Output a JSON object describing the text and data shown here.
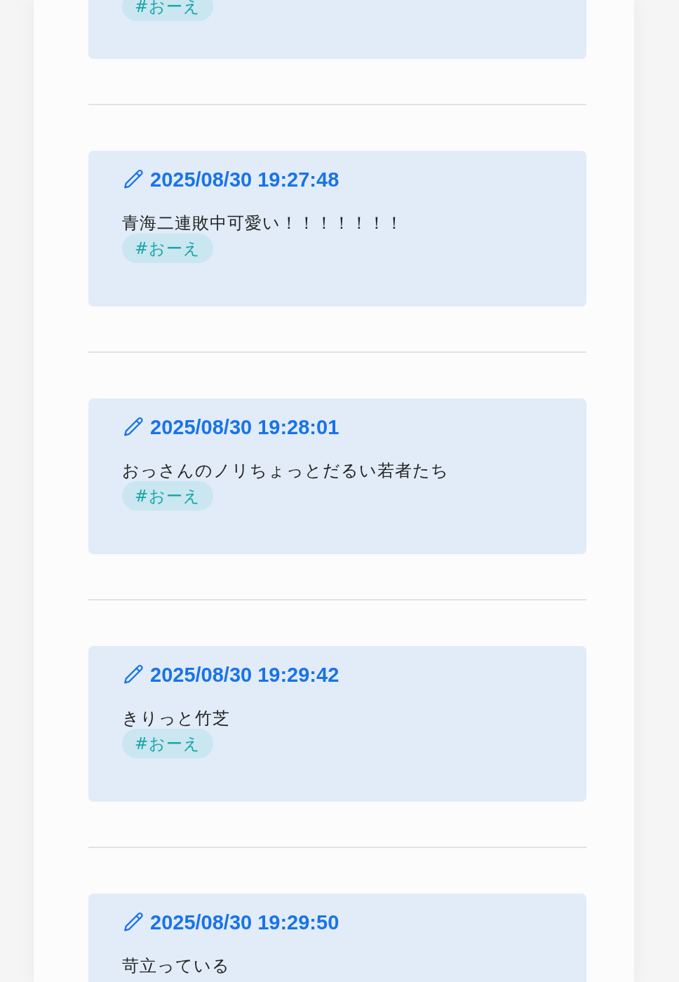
{
  "posts": [
    {
      "tags": [
        "#おーえ"
      ]
    },
    {
      "timestamp": "2025/08/30 19:27:48",
      "text": "青海二連敗中可愛い！！！！！！！",
      "tags": [
        "#おーえ"
      ]
    },
    {
      "timestamp": "2025/08/30 19:28:01",
      "text": "おっさんのノリちょっとだるい若者たち",
      "tags": [
        "#おーえ"
      ]
    },
    {
      "timestamp": "2025/08/30 19:29:42",
      "text": "きりっと竹芝",
      "tags": [
        "#おーえ"
      ]
    },
    {
      "timestamp": "2025/08/30 19:29:50",
      "text": "苛立っている"
    }
  ]
}
